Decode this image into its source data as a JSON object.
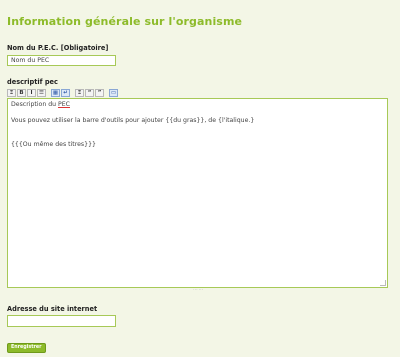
{
  "form": {
    "title": "Information générale sur l'organisme",
    "name_label": "Nom du P.E.C. [Obligatoire]",
    "name_value": "Nom du PEC",
    "desc_label": "descriptif pec",
    "desc_line1": "Description du ",
    "desc_line1_word": "PEC",
    "desc_line2": "Vous pouvez utiliser la barre d'outils pour ajouter {{du gras}}, de {l'italique.}",
    "desc_line3": "{{{Ou même des titres}}}",
    "website_label": "Adresse du site internet",
    "website_value": "",
    "submit_label": "Enregistrer"
  },
  "toolbar": {
    "buttons": [
      {
        "icon": "align-center-icon",
        "glyph": "Ξ"
      },
      {
        "icon": "bold-icon",
        "glyph": "B"
      },
      {
        "icon": "italic-icon",
        "glyph": "I"
      },
      {
        "icon": "list-icon",
        "glyph": "☰"
      },
      {
        "icon": "table-icon",
        "glyph": "▦"
      },
      {
        "icon": "link-icon",
        "glyph": "↵"
      },
      {
        "icon": "heading-icon",
        "glyph": "Ξ"
      },
      {
        "icon": "quote-open-icon",
        "glyph": "“"
      },
      {
        "icon": "quote-close-icon",
        "glyph": "”"
      },
      {
        "icon": "image-icon",
        "glyph": "▭"
      }
    ]
  },
  "colors": {
    "accent": "#8dbb2a",
    "border": "#a7c957",
    "background": "#f3f6e6"
  }
}
